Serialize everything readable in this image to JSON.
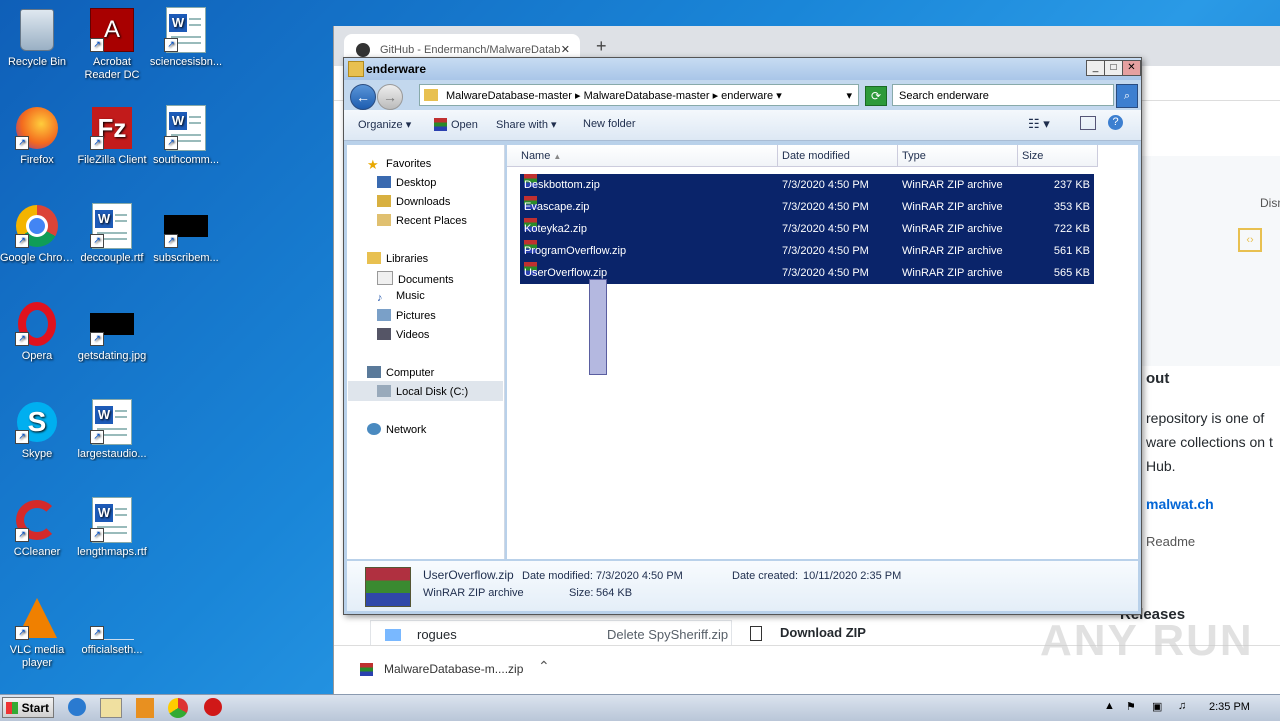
{
  "desktop_icons": [
    {
      "label": "Recycle Bin",
      "icon": "recycle-bin-icon"
    },
    {
      "label": "Acrobat Reader DC",
      "icon": "acrobat-icon"
    },
    {
      "label": "sciencesisbn...",
      "icon": "word-doc-icon"
    },
    {
      "label": "Firefox",
      "icon": "firefox-icon"
    },
    {
      "label": "FileZilla Client",
      "icon": "filezilla-icon"
    },
    {
      "label": "southcomm...",
      "icon": "word-doc-icon"
    },
    {
      "label": "Google Chrome",
      "icon": "chrome-icon"
    },
    {
      "label": "deccouple.rtf",
      "icon": "word-doc-icon"
    },
    {
      "label": "subscribem...",
      "icon": "black-thumbnail-icon"
    },
    {
      "label": "Opera",
      "icon": "opera-icon"
    },
    {
      "label": "getsdating.jpg",
      "icon": "black-thumbnail-icon"
    },
    {
      "label": "Skype",
      "icon": "skype-icon"
    },
    {
      "label": "largestaudio...",
      "icon": "word-doc-icon"
    },
    {
      "label": "CCleaner",
      "icon": "ccleaner-icon"
    },
    {
      "label": "lengthmaps.rtf",
      "icon": "word-doc-icon"
    },
    {
      "label": "VLC media player",
      "icon": "vlc-icon"
    },
    {
      "label": "officialseth...",
      "icon": "blank-file-icon"
    }
  ],
  "browser": {
    "tab_title": "GitHub - Endermanch/MalwareDatab",
    "right_text": {
      "disc": "Disn",
      "about": "out",
      "desc1": "repository is one of",
      "desc2": "ware collections on t",
      "desc3": "Hub.",
      "link": "malwat.ch",
      "readme": "Readme",
      "releases": "Releases"
    },
    "bottom_row": {
      "folder": "rogues",
      "commit": "Delete SpySheriff.zip",
      "download": "Download ZIP"
    },
    "download_bar": {
      "file": "MalwareDatabase-m....zip"
    }
  },
  "explorer": {
    "title": "enderware",
    "breadcrumb": [
      "MalwareDatabase-master",
      "MalwareDatabase-master",
      "enderware"
    ],
    "search_placeholder": "Search enderware",
    "toolbar": {
      "organize": "Organize",
      "open": "Open",
      "share": "Share with",
      "new_folder": "New folder"
    },
    "nav": {
      "favorites": "Favorites",
      "desktop": "Desktop",
      "downloads": "Downloads",
      "recent": "Recent Places",
      "libraries": "Libraries",
      "documents": "Documents",
      "music": "Music",
      "pictures": "Pictures",
      "videos": "Videos",
      "computer": "Computer",
      "local_disk": "Local Disk (C:)",
      "network": "Network"
    },
    "columns": {
      "name": "Name",
      "date": "Date modified",
      "type": "Type",
      "size": "Size"
    },
    "files": [
      {
        "name": "Deskbottom.zip",
        "date": "7/3/2020 4:50 PM",
        "type": "WinRAR ZIP archive",
        "size": "237 KB"
      },
      {
        "name": "Evascape.zip",
        "date": "7/3/2020 4:50 PM",
        "type": "WinRAR ZIP archive",
        "size": "353 KB"
      },
      {
        "name": "Koteyka2.zip",
        "date": "7/3/2020 4:50 PM",
        "type": "WinRAR ZIP archive",
        "size": "722 KB"
      },
      {
        "name": "ProgramOverflow.zip",
        "date": "7/3/2020 4:50 PM",
        "type": "WinRAR ZIP archive",
        "size": "561 KB"
      },
      {
        "name": "UserOverflow.zip",
        "date": "7/3/2020 4:50 PM",
        "type": "WinRAR ZIP archive",
        "size": "565 KB"
      }
    ],
    "details": {
      "name": "UserOverflow.zip",
      "type": "WinRAR ZIP archive",
      "modified_label": "Date modified:",
      "modified": "7/3/2020 4:50 PM",
      "size_label": "Size:",
      "size": "564 KB",
      "created_label": "Date created:",
      "created": "10/11/2020 2:35 PM"
    }
  },
  "taskbar": {
    "start": "Start",
    "clock": "2:35 PM"
  },
  "watermark": "ANY RUN"
}
